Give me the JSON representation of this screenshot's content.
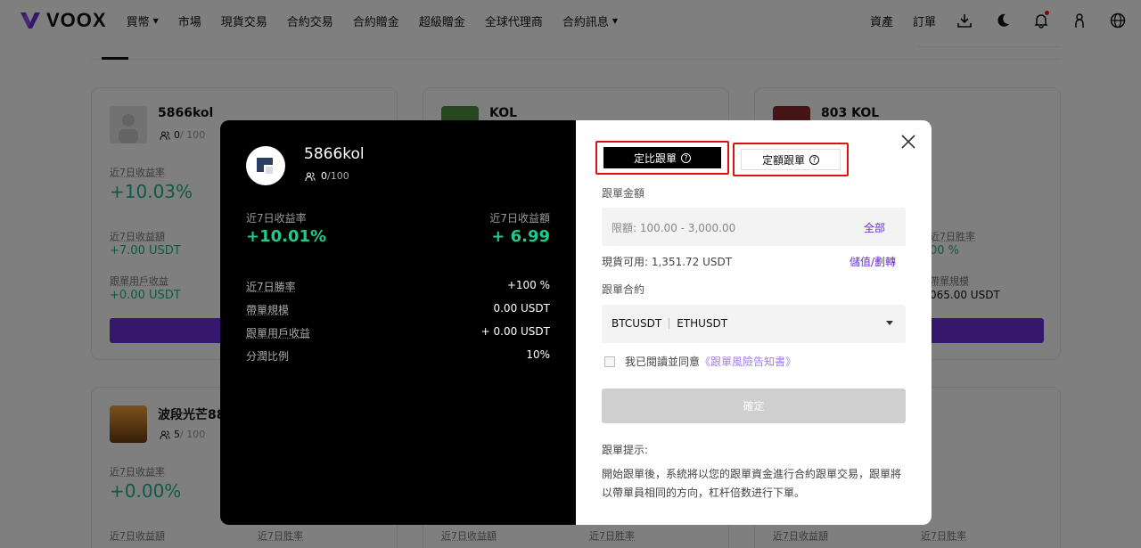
{
  "brand": {
    "name": "VOOX",
    "accent": "#6b2fd9",
    "green": "#1fb48a"
  },
  "nav": {
    "items": [
      {
        "label": "買幣",
        "dropdown": true
      },
      {
        "label": "市場",
        "dropdown": false
      },
      {
        "label": "現貨交易",
        "dropdown": false
      },
      {
        "label": "合約交易",
        "dropdown": false
      },
      {
        "label": "合約贈金",
        "dropdown": false
      },
      {
        "label": "超級贈金",
        "dropdown": false
      },
      {
        "label": "全球代理商",
        "dropdown": false
      },
      {
        "label": "合約訊息",
        "dropdown": true
      }
    ],
    "right": {
      "assets": "資產",
      "orders": "訂單"
    },
    "icons": [
      "download-icon",
      "moon-icon",
      "bell-icon",
      "user-icon",
      "globe-icon"
    ]
  },
  "cards": [
    {
      "name": "5866kol",
      "followers": "0",
      "max": "/ 100",
      "l1": "近7日收益率",
      "v1": "+10.03%",
      "l2": "近7日收益額",
      "v2": "+7.00 USDT",
      "l3": "跟單用戶收益",
      "v3": "+0.00 USDT"
    },
    {
      "name": "KOL"
    },
    {
      "name": "803 KOL",
      "r1": "近7日胜率",
      "rv1": "00 %",
      "r2": "帶單規模",
      "rv2": "065.00 USDT"
    },
    {
      "name": "波段光芒88",
      "followers": "5",
      "max": "/ 100",
      "l1": "近7日收益率",
      "v1": "+0.00%",
      "l2": "近7日收益額",
      "l2b": "近7日胜率"
    },
    {
      "l2": "近7日收益額",
      "l2b": "近7日胜率"
    },
    {
      "l2": "近7日收益額",
      "l2b": "近7日胜率"
    }
  ],
  "modal": {
    "trader": {
      "name": "5866kol",
      "followers": "0",
      "max": "/100",
      "roi_label": "近7日收益率",
      "roi_value": "+10.01%",
      "pnl_label": "近7日收益額",
      "pnl_value": "+ 6.99",
      "stats": [
        {
          "label": "近7日勝率",
          "value": "+100 %"
        },
        {
          "label": "帶單規模",
          "value": "0.00 USDT"
        },
        {
          "label": "跟單用戶收益",
          "value": "+ 0.00 USDT"
        },
        {
          "label": "分潤比例",
          "value": "10%"
        }
      ]
    },
    "form": {
      "mode_ratio": "定比跟單",
      "mode_fixed": "定額跟單",
      "amount_label": "跟單金額",
      "amount_placeholder": "限額:  100.00 - 3,000.00",
      "all_label": "全部",
      "available": "現貨可用: 1,351.72 USDT",
      "deposit": "儲值/劃轉",
      "contract_label": "跟單合約",
      "contracts": [
        "BTCUSDT",
        "ETHUSDT"
      ],
      "agree_text": "我已閱讀並同意",
      "agree_link": "《跟單風險告知書》",
      "confirm": "確定",
      "tip_title": "跟單提示:",
      "tip_body": "開始跟單後，系統將以您的跟單資金進行合約跟單交易，跟單將以帶單員相同的方向，杠杆倍数进行下單。"
    }
  }
}
